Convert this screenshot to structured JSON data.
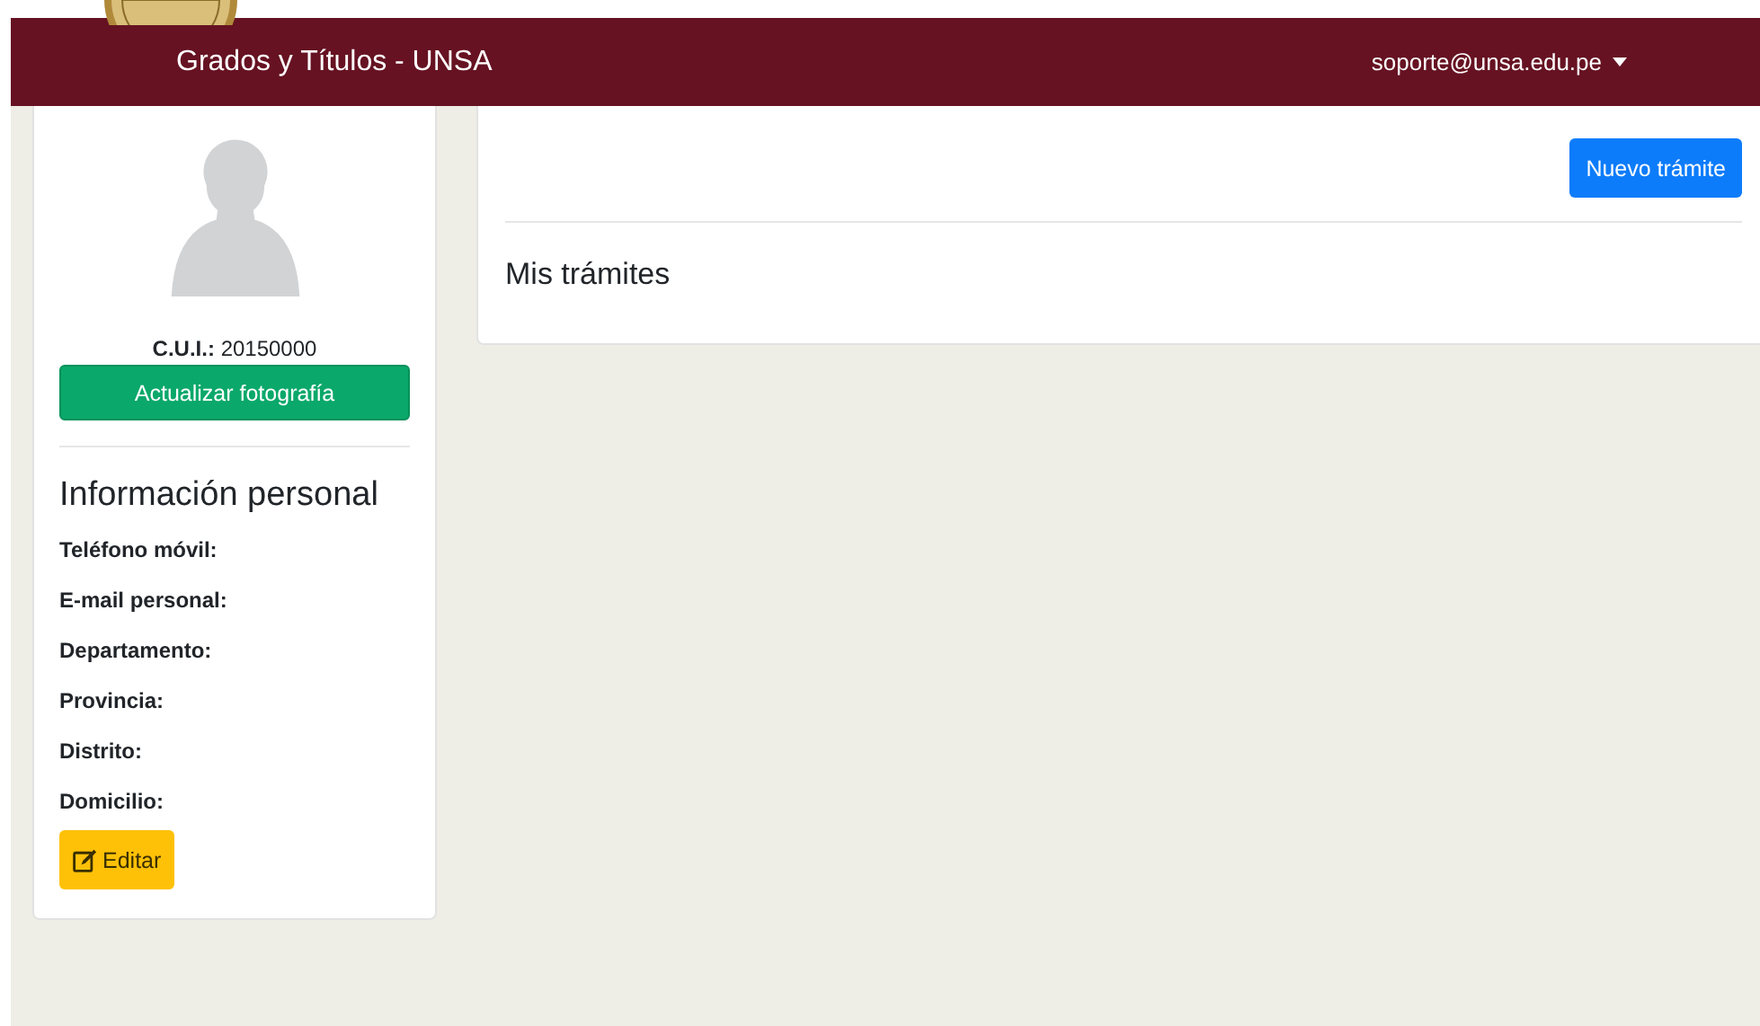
{
  "navbar": {
    "brand": "Grados y Títulos - UNSA",
    "user_menu": "soporte@unsa.edu.pe"
  },
  "profile": {
    "cui_label": "C.U.I.:",
    "cui_value": "20150000",
    "photo_button": "Actualizar fotografía",
    "section_title": "Información personal",
    "fields": [
      {
        "label": "Teléfono móvil:"
      },
      {
        "label": "E-mail personal:"
      },
      {
        "label": "Departamento:"
      },
      {
        "label": "Provincia:"
      },
      {
        "label": "Distrito:"
      },
      {
        "label": "Domicilio:"
      }
    ],
    "edit_button": "Editar"
  },
  "main": {
    "new_button": "Nuevo trámite",
    "title": "Mis trámites"
  }
}
